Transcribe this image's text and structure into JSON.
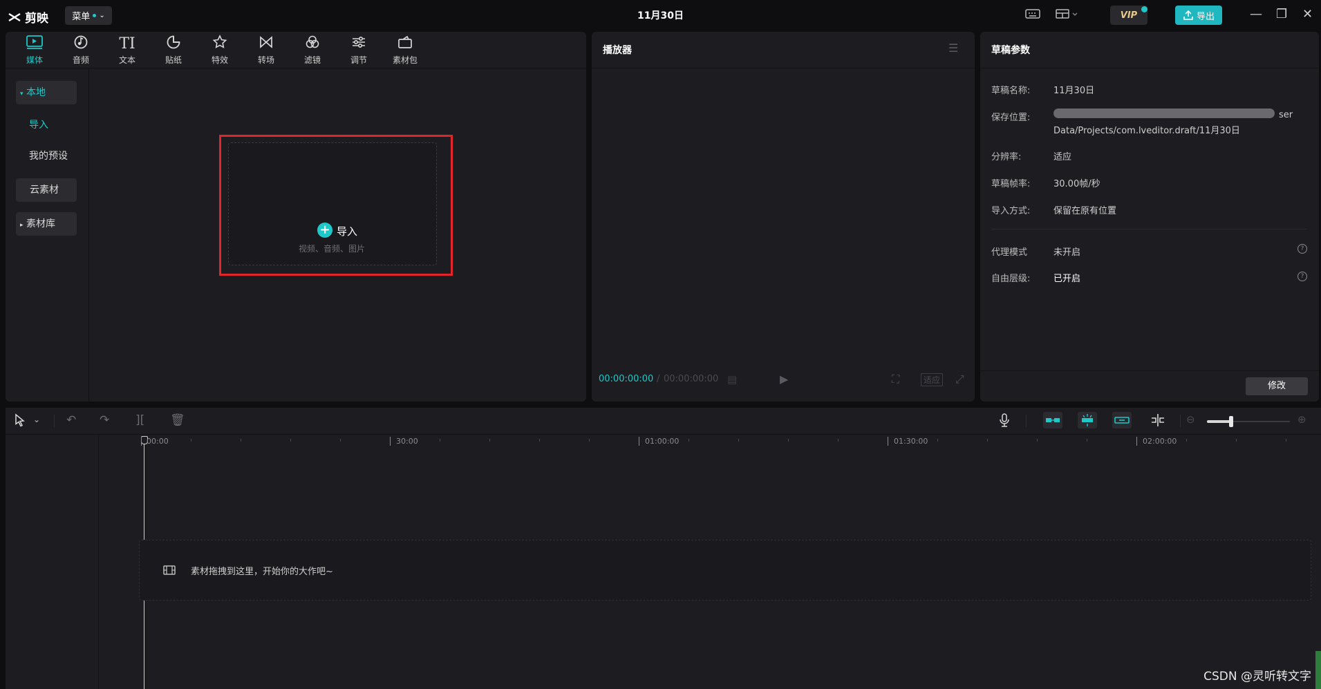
{
  "app": {
    "name": "剪映",
    "menu_label": "菜单",
    "title": "11月30日",
    "vip_label": "VIP",
    "export_label": "导出"
  },
  "toolbar": {
    "tabs": [
      {
        "label": "媒体",
        "icon": "media-icon",
        "active": true
      },
      {
        "label": "音频",
        "icon": "audio-icon"
      },
      {
        "label": "文本",
        "icon": "text-icon"
      },
      {
        "label": "贴纸",
        "icon": "sticker-icon"
      },
      {
        "label": "特效",
        "icon": "effects-icon"
      },
      {
        "label": "转场",
        "icon": "transition-icon"
      },
      {
        "label": "滤镜",
        "icon": "filter-icon"
      },
      {
        "label": "调节",
        "icon": "adjust-icon"
      },
      {
        "label": "素材包",
        "icon": "package-icon"
      }
    ]
  },
  "sidebar": {
    "local": "本地",
    "import": "导入",
    "presets": "我的预设",
    "cloud": "云素材",
    "library": "素材库"
  },
  "import_zone": {
    "label": "导入",
    "hint": "视频、音频、图片"
  },
  "player": {
    "title": "播放器",
    "current_time": "00:00:00:00",
    "total_time": "00:00:00:00",
    "fit_label": "适应"
  },
  "params": {
    "title": "草稿参数",
    "rows": [
      {
        "label": "草稿名称:",
        "value": "11月30日"
      },
      {
        "label": "保存位置:",
        "value": "ser",
        "value2": "Data/Projects/com.lveditor.draft/11月30日"
      },
      {
        "label": "分辨率:",
        "value": "适应"
      },
      {
        "label": "草稿帧率:",
        "value": "30.00帧/秒"
      },
      {
        "label": "导入方式:",
        "value": "保留在原有位置"
      },
      {
        "label": "代理模式",
        "value": "未开启"
      },
      {
        "label": "自由层级:",
        "value": "已开启"
      }
    ],
    "modify_label": "修改"
  },
  "timeline": {
    "ticks": [
      "00:00",
      "30:00",
      "01:00:00",
      "01:30:00",
      "02:00:00"
    ],
    "drop_hint": "素材拖拽到这里，开始你的大作吧~"
  },
  "watermark": "CSDN @灵听转文字",
  "colors": {
    "accent": "#1ec8c8",
    "highlight_box": "#e0262b",
    "panel": "#1d1d21",
    "background": "#0e0e10"
  }
}
